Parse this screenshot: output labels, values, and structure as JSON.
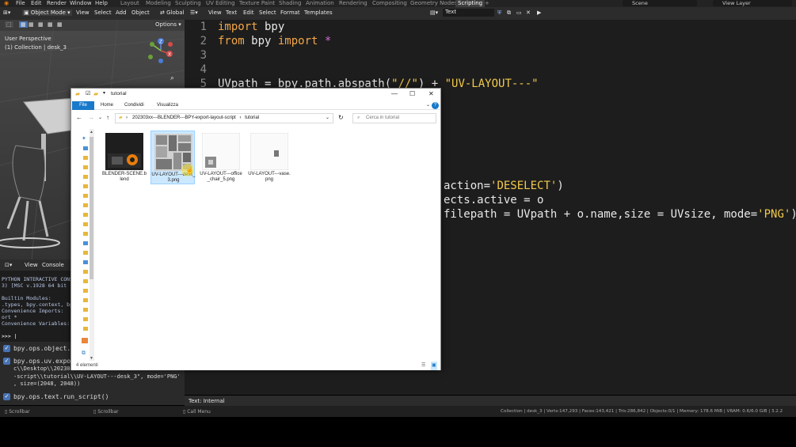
{
  "topbar": {
    "menus": [
      "File",
      "Edit",
      "Render",
      "Window",
      "Help"
    ],
    "workspaces": [
      "Layout",
      "Modeling",
      "Sculpting",
      "UV Editing",
      "Texture Paint",
      "Shading",
      "Animation",
      "Rendering",
      "Compositing",
      "Geometry Nodes",
      "Scripting"
    ],
    "active_workspace": "Scripting",
    "add_tab": "+",
    "scene": "Scene",
    "view_layer": "View Layer"
  },
  "viewport": {
    "mode": "Object Mode",
    "menus": [
      "View",
      "Select",
      "Add",
      "Object"
    ],
    "transform": "Global",
    "options": "Options",
    "perspective": "User Perspective",
    "collection": "(1) Collection | desk_3",
    "gizmo": {
      "x": "X",
      "y": "Y",
      "z": "Z"
    }
  },
  "console": {
    "header_menus": [
      "View",
      "Console"
    ],
    "lines": [
      "PYTHON INTERACTIVE CONSOLE",
      "3) [MSC v.1928 64 bit (",
      "",
      "Builtin Modules:",
      ".types, bpy.context, bpy",
      "Convenience Imports:",
      "ort *",
      "Convenience Variables: C",
      "",
      ">>> |"
    ]
  },
  "info": {
    "entries": [
      {
        "text": "bpy.ops.object.se"
      },
      {
        "text": "bpy.ops.uv.export",
        "extra": [
          "c\\\\Desktop\\\\20230",
          "-script\\\\tutorial\\\\UV-LAYOUT---desk_3\", mode='PNG'",
          ", size=(2048, 2048))"
        ]
      },
      {
        "text": "bpy.ops.text.run_script()"
      }
    ]
  },
  "text_editor": {
    "menus": [
      "View",
      "Text",
      "Edit",
      "Select",
      "Format",
      "Templates"
    ],
    "file_name": "Text",
    "footer": "Text: Internal",
    "line_numbers": [
      "1",
      "2",
      "3",
      "4",
      "5"
    ],
    "lines": {
      "l1_kw": "import",
      "l1_rest": " bpy",
      "l2_kw1": "from",
      "l2_mid": " bpy ",
      "l2_kw2": "import",
      "l2_op": " *",
      "l5_a": "UVpath = bpy.path.abspath(",
      "l5_s1": "\"//\"",
      "l5_b": ") + ",
      "l5_s2": "\"UV-LAYOUT---\"",
      "l12_a": "action=",
      "l12_s": "'DESELECT'",
      "l12_b": ")",
      "l13": "ects.active = o",
      "l14_a": "filepath = UVpath + o.name,size = UVsize, mode=",
      "l14_s": "'PNG'",
      "l14_b": ")"
    }
  },
  "statusbar": {
    "left1": "Scrollbar",
    "left2": "Scrollbar",
    "left3": "Call Menu",
    "right": "Collection | desk_3 | Verts:147,293 | Faces:143,421 | Tris:286,842 | Objects:0/1 | Memory: 178.6 MiB | VRAM: 0.6/6.0 GiB | 3.2.2"
  },
  "explorer": {
    "title": "tutorial",
    "window_controls": {
      "minimize": "—",
      "maximize": "☐",
      "close": "✕"
    },
    "ribbon_tabs": [
      "File",
      "Home",
      "Condividi",
      "Visualizza"
    ],
    "help": "?",
    "breadcrumb": [
      "202303xx---BLENDER---BPY-export-layout-script",
      "tutorial"
    ],
    "search_placeholder": "Cerca in tutorial",
    "files": [
      {
        "name": "BLENDER-SCENE.blend",
        "selected": false
      },
      {
        "name": "UV-LAYOUT---desk_3.png",
        "selected": true
      },
      {
        "name": "UV-LAYOUT---office_chair_5.png",
        "selected": false
      },
      {
        "name": "UV-LAYOUT---vase.png",
        "selected": false
      }
    ],
    "status": "4 elementi",
    "accent": "#1979ca"
  }
}
